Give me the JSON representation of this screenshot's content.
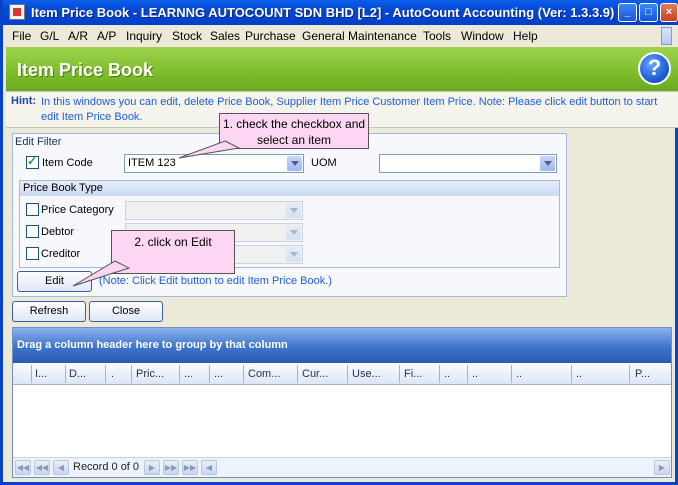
{
  "window": {
    "title": "Item Price Book - LEARNNG AUTOCOUNT SDN BHD [L2] - AutoCount Accounting (Ver: 1.3.3.9)",
    "minimize": "_",
    "maximize": "□",
    "close": "×"
  },
  "menu": {
    "items": [
      {
        "label": "File"
      },
      {
        "label": "G/L"
      },
      {
        "label": "A/R"
      },
      {
        "label": "A/P"
      },
      {
        "label": "Inquiry"
      },
      {
        "label": "Stock"
      },
      {
        "label": "Sales"
      },
      {
        "label": "Purchase"
      },
      {
        "label": "General Maintenance"
      },
      {
        "label": "Tools"
      },
      {
        "label": "Window"
      },
      {
        "label": "Help"
      }
    ]
  },
  "banner": {
    "title": "Item Price Book",
    "help": "?"
  },
  "hint": {
    "label": "Hint:",
    "text": "In this windows you can edit, delete Price Book, Supplier Item Price  Customer Item Price. Note: Please click edit button to start edit Item Price Book."
  },
  "filter": {
    "caption": "Edit Filter",
    "item_code_label": "Item Code",
    "item_code_checked": true,
    "item_code_value": "ITEM 123",
    "uom_label": "UOM",
    "uom_value": ""
  },
  "price_book_type": {
    "caption": "Price Book Type",
    "options": [
      {
        "label": "Price Category",
        "checked": false
      },
      {
        "label": "Debtor",
        "checked": false
      },
      {
        "label": "Creditor",
        "checked": false
      }
    ]
  },
  "edit": {
    "label": "Edit",
    "note": "(Note: Click Edit button to edit Item Price Book.)"
  },
  "buttons": {
    "refresh": "Refresh",
    "close": "Close"
  },
  "callouts": {
    "one": "1. check the checkbox and select an item",
    "two": "2. click on Edit"
  },
  "grid": {
    "group_hint": "Drag a column header here to group by that column",
    "columns": [
      "I...",
      "D...",
      ".",
      "Pric...",
      "...",
      "...",
      "Com...",
      "Cur...",
      "Use...",
      "Fi...",
      "..",
      "..",
      "..",
      "..",
      "P..."
    ],
    "record_text": "Record 0 of 0"
  },
  "colors": {
    "banner": "#7fbf2d",
    "titlebar": "#0446d8",
    "callout": "#fcd6f2",
    "hint_text": "#1f5fd6"
  }
}
